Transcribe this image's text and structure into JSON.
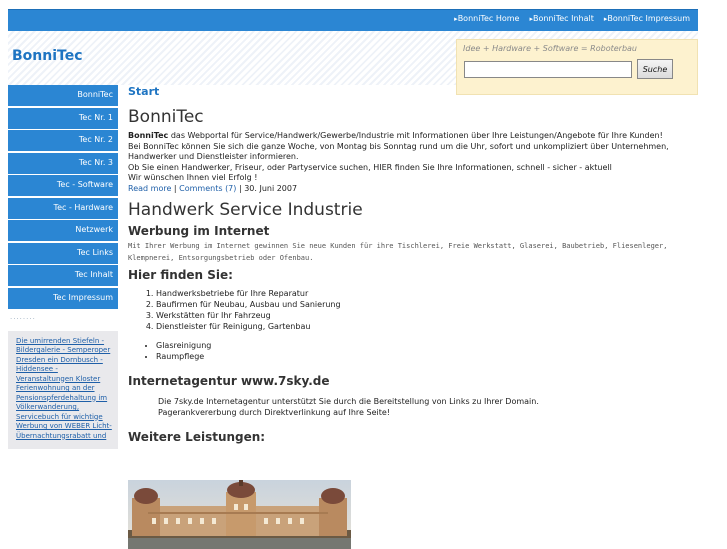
{
  "topnav": {
    "items": [
      "BonniTec Home",
      "BonniTec Inhalt",
      "BonniTec Impressum"
    ]
  },
  "header": {
    "site_title": "BonniTec"
  },
  "search": {
    "caption": "Idee + Hardware + Software = Roboterbau",
    "input_value": "",
    "button_label": "Suche"
  },
  "sidebar": {
    "items": [
      "BonniTec",
      "Tec Nr. 1",
      "Tec Nr. 2",
      "Tec Nr. 3",
      "Tec - Software",
      "Tec - Hardware",
      "Netzwerk",
      "Tec Links",
      "Tec Inhalt",
      "Tec Impressum"
    ],
    "dots": "........",
    "links_text": "Die umirrenden Stiefeln - Bildergalerie - Semperoper Dresden ein Dornbusch - Hiddensee - Veranstaltungen Kloster Ferienwohnung an der Pensionspferdehaltung im Völkerwanderung, Servicebuch für wichtige Werbung von WEBER Licht-Übernachtungsrabatt und"
  },
  "main": {
    "breadcrumb": "Start",
    "title": "BonniTec",
    "intro_bold": "BonniTec",
    "intro_line1": " das Webportal für Service/Handwerk/Gewerbe/Industrie mit Informationen über Ihre Leistungen/Angebote für Ihre Kunden!",
    "intro_line2": "Bei BonniTec können Sie sich die ganze Woche, von Montag bis Sonntag rund um die Uhr, sofort und unkompliziert über Unternehmen, Handwerker und Dienstleister informieren.",
    "intro_line3": "Ob Sie einen Handwerker, Friseur, oder Partyservice suchen, HIER finden Sie Ihre Informationen, schnell - sicher - aktuell",
    "intro_line4": "Wir wünschen Ihnen viel Erfolg !",
    "read_more": "Read more",
    "comments": "Comments (7)",
    "sep": " | ",
    "date": "30. Juni 2007",
    "h_service": "Handwerk Service Industrie",
    "h_werbung": "Werbung im Internet",
    "werbung_text": "Mit Ihrer Werbung im Internet gewinnen Sie neue Kunden für ihre Tischlerei, Freie Werkstatt, Glaserei, Baubetrieb, Fliesenleger, Klempnerei, Entsorgungsbetrieb oder Ofenbau.",
    "h_finden": "Hier finden Sie:",
    "ol_items": [
      "Handwerksbetriebe für Ihre Reparatur",
      "Baufirmen für Neubau, Ausbau und Sanierung",
      "Werkstätten für Ihr Fahrzeug",
      "Dienstleister für Reinigung, Gartenbau"
    ],
    "ul_items": [
      "Glasreinigung",
      "Raumpflege"
    ],
    "h_agentur": "Internetagentur www.7sky.de",
    "agentur_line1": "Die 7sky.de Internetagentur unterstützt Sie durch die Bereitstellung von Links zu Ihrer Domain.",
    "agentur_line2": "Pagerankvererbung durch Direktverlinkung auf Ihre Seite!",
    "h_weitere": "Weitere Leistungen:"
  },
  "colors": {
    "nav_blue": "#2b86d3",
    "search_bg": "#fdf2cf",
    "link_blue": "#1e5fa8"
  }
}
